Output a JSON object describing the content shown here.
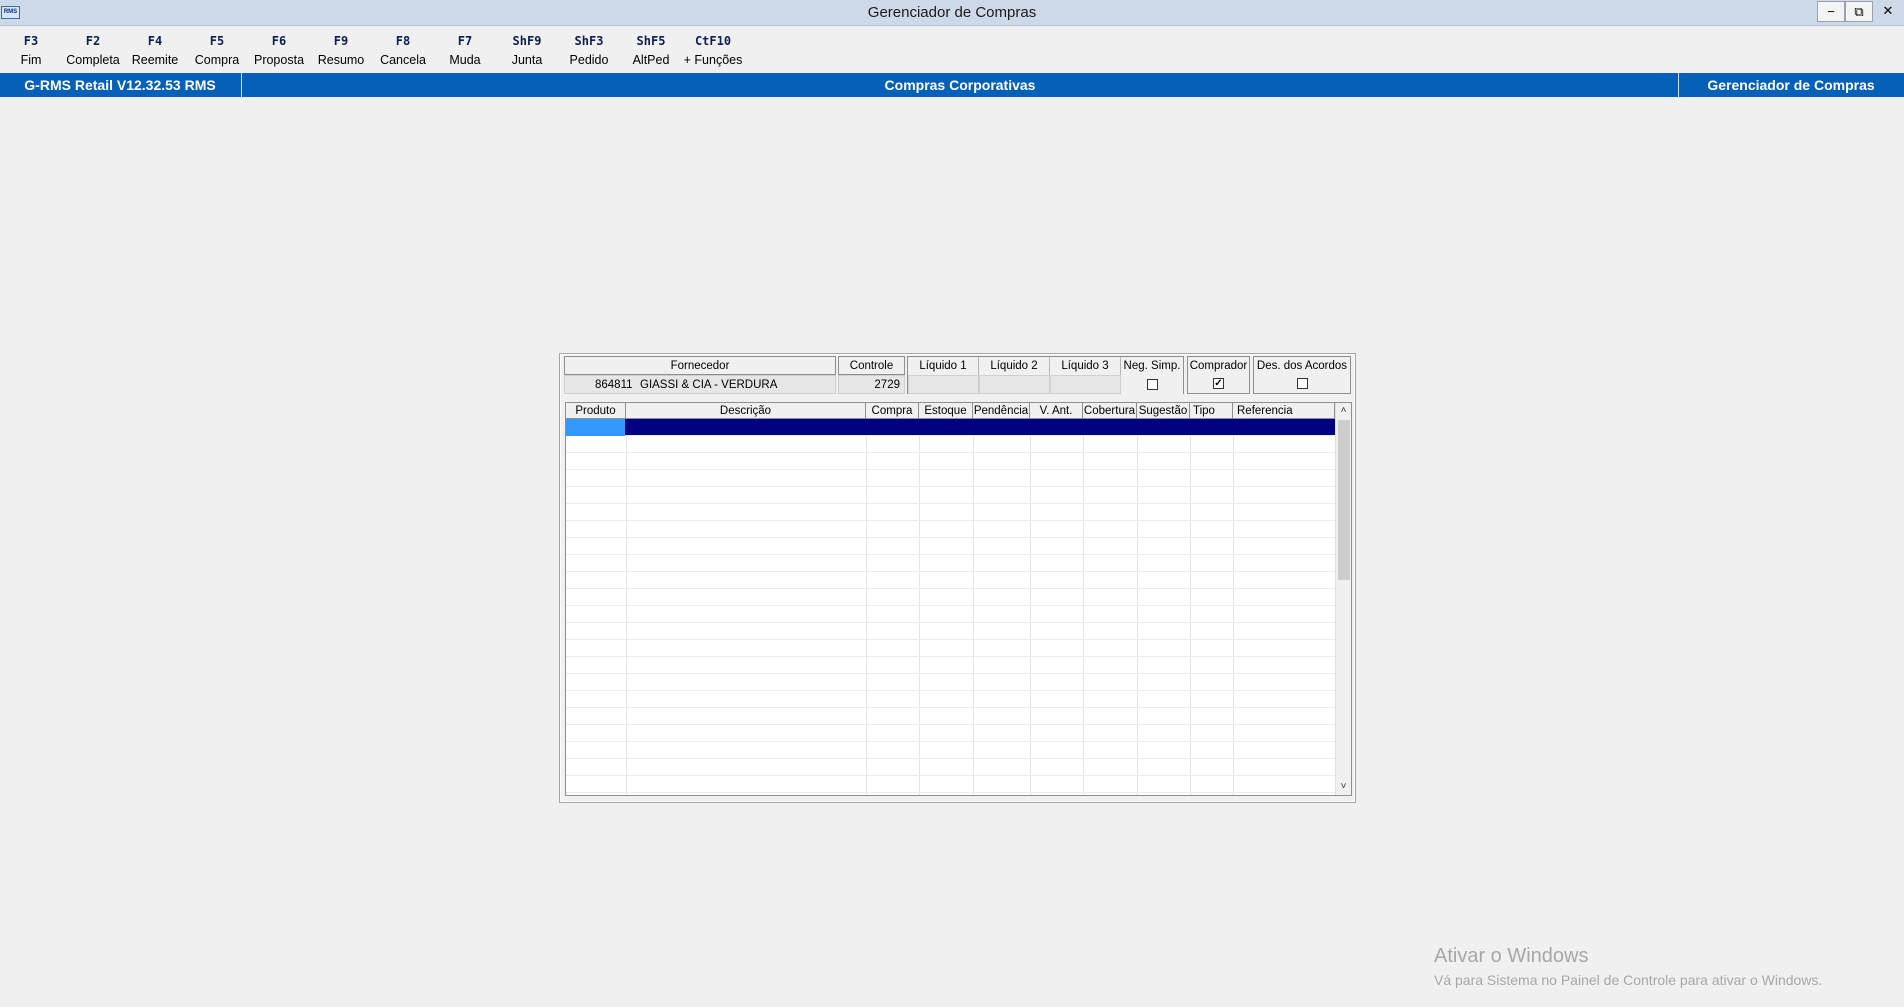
{
  "window": {
    "app_icon_text": "RMS",
    "title": "Gerenciador de Compras",
    "minimize": "−",
    "restore": "⧉",
    "close": "✕"
  },
  "toolbar": {
    "keys": [
      {
        "key": "F3",
        "label": "Fim"
      },
      {
        "key": "F2",
        "label": "Completa"
      },
      {
        "key": "F4",
        "label": "Reemite"
      },
      {
        "key": "F5",
        "label": "Compra"
      },
      {
        "key": "F6",
        "label": "Proposta"
      },
      {
        "key": "F9",
        "label": "Resumo"
      },
      {
        "key": "F8",
        "label": "Cancela"
      },
      {
        "key": "F7",
        "label": "Muda"
      },
      {
        "key": "ShF9",
        "label": "Junta"
      },
      {
        "key": "ShF3",
        "label": "Pedido"
      },
      {
        "key": "ShF5",
        "label": "AltPed"
      },
      {
        "key": "CtF10",
        "label": "+ Funções"
      }
    ]
  },
  "statusbar": {
    "left": "G-RMS Retail V12.32.53 RMS",
    "center": "Compras Corporativas",
    "right": "Gerenciador de Compras"
  },
  "header_fields": {
    "fornecedor_label": "Fornecedor",
    "fornecedor_code": "864811",
    "fornecedor_name": "GIASSI & CIA - VERDURA",
    "controle_label": "Controle",
    "controle_value": "2729",
    "liquido1_label": "Líquido 1",
    "liquido2_label": "Líquido 2",
    "liquido3_label": "Líquido 3",
    "neg_simp_label": "Neg. Simp.",
    "comprador_label": "Comprador",
    "des_acordos_label": "Des. dos Acordos",
    "neg_simp_checked": false,
    "comprador_checked": true,
    "des_acordos_checked": false
  },
  "grid": {
    "columns": [
      "Produto",
      "Descrição",
      "Compra",
      "Estoque",
      "Pendência",
      "V. Ant.",
      "Cobertura",
      "Sugestão",
      "Tipo",
      "Referencia"
    ],
    "scroll_up": "˄",
    "scroll_down": "˅"
  },
  "watermark": {
    "title": "Ativar o Windows",
    "subtitle": "Vá para Sistema no Painel de Controle para ativar o Windows."
  }
}
